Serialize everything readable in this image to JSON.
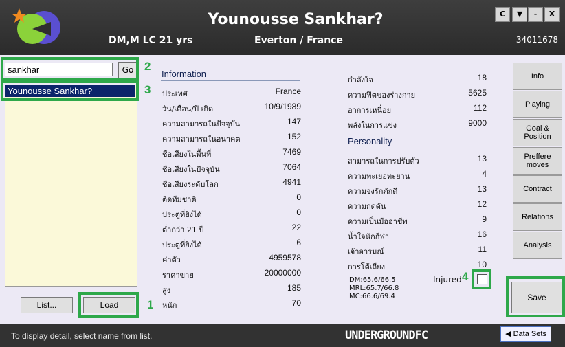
{
  "header": {
    "title": "Younousse Sankhar?",
    "position_age": "DM,M LC 21 yrs",
    "club_nation": "Everton / France",
    "player_id": "34011678",
    "window_buttons": [
      "C",
      "▼",
      "-",
      "X"
    ]
  },
  "search": {
    "value": "sankhar",
    "go_label": "Go"
  },
  "list": {
    "selected_item": "Younousse Sankhar?"
  },
  "buttons": {
    "list_label": "List...",
    "load_label": "Load",
    "save_label": "Save"
  },
  "annotations": [
    "1",
    "2",
    "3",
    "4"
  ],
  "info": {
    "heading": "Information",
    "rows": [
      {
        "label": "ประเทศ",
        "value": "France"
      },
      {
        "label": "วัน/เดือน/ปี เกิด",
        "value": "10/9/1989"
      },
      {
        "label": "ความสามารถในปัจจุบัน",
        "value": "147"
      },
      {
        "label": "ความสามารถในอนาคต",
        "value": "152"
      },
      {
        "label": "ชื่อเสียงในพื้นที่",
        "value": "7469"
      },
      {
        "label": "ชื่อเสียงในปัจจุบัน",
        "value": "7064"
      },
      {
        "label": "ชื่อเสียงระดับโลก",
        "value": "4941"
      },
      {
        "label": "ติดทีมชาติ",
        "value": "0"
      },
      {
        "label": "ประตูที่ยิงได้",
        "value": "0"
      },
      {
        "label": "ต่ำกว่า 21 ปี",
        "value": "22"
      },
      {
        "label": "ประตูที่ยิงได้",
        "value": "6"
      },
      {
        "label": "ค่าตัว",
        "value": "4959578"
      },
      {
        "label": "ราคาขาย",
        "value": "20000000"
      },
      {
        "label": "สูง",
        "value": "185"
      },
      {
        "label": "หนัก",
        "value": "70"
      }
    ]
  },
  "condition": {
    "rows": [
      {
        "label": "กำลังใจ",
        "value": "18"
      },
      {
        "label": "ความฟิตของร่างกาย",
        "value": "5625"
      },
      {
        "label": "อาการเหนื่อย",
        "value": "112"
      },
      {
        "label": "พลังในการแข่ง",
        "value": "9000"
      }
    ]
  },
  "personality": {
    "heading": "Personality",
    "rows": [
      {
        "label": "สามารถในการปรับตัว",
        "value": "13"
      },
      {
        "label": "ความทะเยอทะยาน",
        "value": "4"
      },
      {
        "label": "ความจงรักภักดี",
        "value": "13"
      },
      {
        "label": "ความกดดัน",
        "value": "12"
      },
      {
        "label": "ความเป็นมืออาชีพ",
        "value": "9"
      },
      {
        "label": "น้ำใจนักกีฬา",
        "value": "16"
      },
      {
        "label": "เจ้าอารมณ์",
        "value": "11"
      },
      {
        "label": "การโต้เถียง",
        "value": "10"
      }
    ]
  },
  "ratings": {
    "line1": "DM:65.6/66.5",
    "line2": "MRL:65.7/66.8",
    "line3": "MC:66.6/69.4"
  },
  "injured": {
    "label": "Injured",
    "checked": false
  },
  "tabs": [
    "Info",
    "Playing",
    "Goal &\nPosition",
    "Preffere\nmoves",
    "Contract",
    "Relations",
    "Analysis"
  ],
  "footer": {
    "status": "To display detail, select name from list.",
    "brand": "UNDERGROUNDFC",
    "data_sets_label": "Data Sets"
  },
  "colors": {
    "highlight": "#2ea84a",
    "selection": "#0b246a",
    "header_bg": "#333333"
  }
}
